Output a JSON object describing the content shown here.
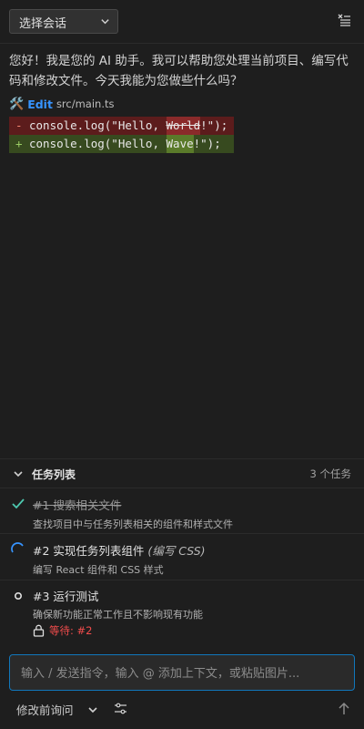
{
  "header": {
    "session_select": "选择会话",
    "menu_icon": "clear-list-icon"
  },
  "message": {
    "text": "您好！我是您的 AI 助手。我可以帮助您处理当前项目、编写代码和修改文件。今天我能为您做些什么吗？"
  },
  "edit": {
    "icon": "tools-icon",
    "label": "Edit",
    "path": "src/main.ts"
  },
  "diff": {
    "removed": {
      "sign": "-",
      "before": "console.log(\"Hello, ",
      "changed": "World",
      "after": "!\");"
    },
    "added": {
      "sign": "+",
      "before": "console.log(\"Hello, ",
      "changed": "Wave",
      "after": "!\");"
    }
  },
  "tasks": {
    "title": "任务列表",
    "count": "3 个任务",
    "items": [
      {
        "status": "done",
        "icon": "check-icon",
        "title": "#1 搜索相关文件",
        "note": "",
        "desc": "查找项目中与任务列表相关的组件和样式文件"
      },
      {
        "status": "in-progress",
        "icon": "spinner-icon",
        "title": "#2 实现任务列表组件",
        "note": "(编写 CSS)",
        "desc": "编写 React 组件和 CSS 样式"
      },
      {
        "status": "pending",
        "icon": "circle-icon",
        "title": "#3 运行测试",
        "note": "",
        "desc": "确保新功能正常工作且不影响现有功能",
        "waiting": "等待: #2"
      }
    ]
  },
  "input": {
    "placeholder": "输入 / 发送指令，输入 @ 添加上下文，或粘贴图片..."
  },
  "footer": {
    "mode": "修改前询问"
  },
  "colors": {
    "accent": "#1177bb",
    "link": "#3794ff",
    "success": "#4ec9b0",
    "danger": "#f14c4c"
  }
}
